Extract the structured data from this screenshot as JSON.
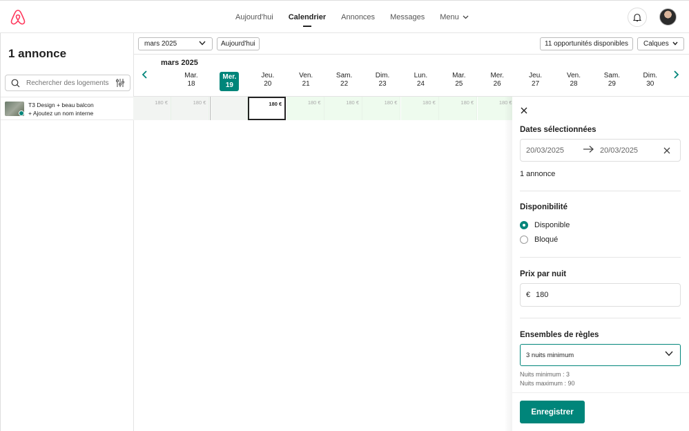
{
  "nav": {
    "links": [
      "Aujourd'hui",
      "Calendrier",
      "Annonces",
      "Messages",
      "Menu"
    ],
    "active_index": 1,
    "brand_color": "#FF385C",
    "icons": [
      "airbnb-logo-icon",
      "bell-icon",
      "avatar"
    ]
  },
  "sidebar": {
    "title": "1 annonce",
    "search_placeholder": "Rechercher des logements",
    "listing_name": "T3 Design + beau balcon",
    "listing_sub": "+ Ajoutez un nom interne",
    "status_color": "#00857A"
  },
  "toolbar": {
    "month": "mars 2025",
    "today": "Aujourd'hui",
    "opportunities": "11 opportunités disponibles",
    "layers": "Calques"
  },
  "calendar": {
    "month_label": "mars 2025",
    "days": [
      {
        "dow": "Mar.",
        "num": "18"
      },
      {
        "dow": "Mer.",
        "num": "19"
      },
      {
        "dow": "Jeu.",
        "num": "20"
      },
      {
        "dow": "Ven.",
        "num": "21"
      },
      {
        "dow": "Sam.",
        "num": "22"
      },
      {
        "dow": "Dim.",
        "num": "23"
      },
      {
        "dow": "Lun.",
        "num": "24"
      },
      {
        "dow": "Mar.",
        "num": "25"
      },
      {
        "dow": "Mer.",
        "num": "26"
      },
      {
        "dow": "Jeu.",
        "num": "27"
      },
      {
        "dow": "Ven.",
        "num": "28"
      },
      {
        "dow": "Sam.",
        "num": "29"
      },
      {
        "dow": "Dim.",
        "num": "30"
      }
    ],
    "today_index": 1,
    "prices": [
      "180 €",
      "180 €",
      "",
      "180 €",
      "180 €",
      "180 €",
      "180 €",
      "180 €",
      "180 €",
      "180 €"
    ],
    "selected_price": "180 €",
    "accent_color": "#00857A"
  },
  "panel": {
    "title": "Dates sélectionnées",
    "date_from": "20/03/2025",
    "date_to": "20/03/2025",
    "count": "1 annonce",
    "availability_title": "Disponibilité",
    "option_available": "Disponible",
    "option_blocked": "Bloqué",
    "price_title": "Prix par nuit",
    "currency": "€",
    "price": "180",
    "rules_title": "Ensembles de règles",
    "rule_selected": "3 nuits minimum",
    "min_nights": "Nuits minimum : 3",
    "max_nights": "Nuits maximum : 90",
    "save": "Enregistrer"
  }
}
